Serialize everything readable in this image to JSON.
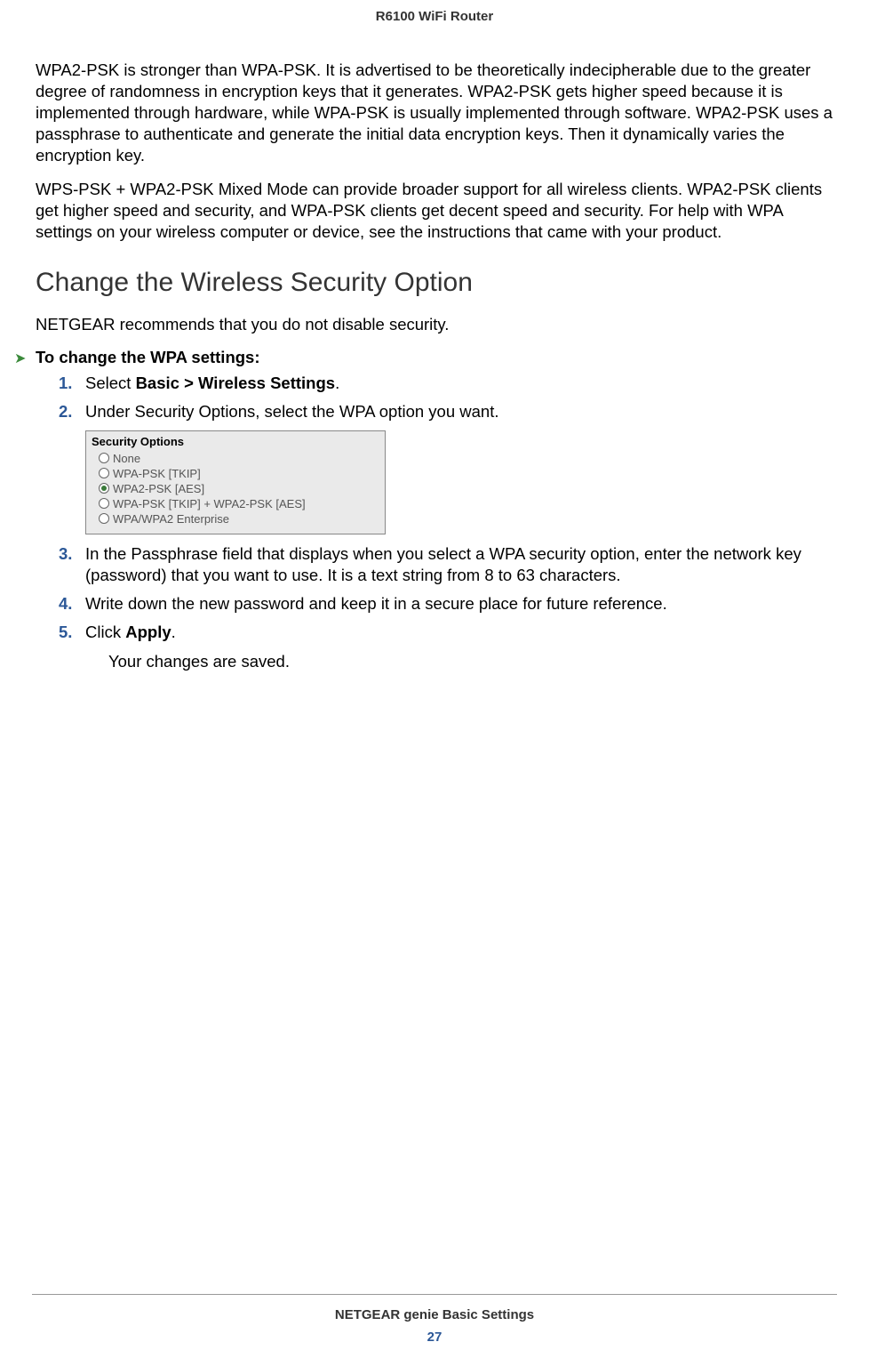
{
  "header": {
    "title": "R6100 WiFi Router"
  },
  "paragraphs": {
    "p1": "WPA2-PSK is stronger than WPA-PSK. It is advertised to be theoretically indecipherable due to the greater degree of randomness in encryption keys that it generates. WPA2-PSK gets higher speed because it is implemented through hardware, while WPA-PSK is usually implemented through software. WPA2-PSK uses a passphrase to authenticate and generate the initial data encryption keys. Then it dynamically varies the encryption key.",
    "p2": "WPS-PSK + WPA2-PSK Mixed Mode can provide broader support for all wireless clients. WPA2-PSK clients get higher speed and security, and WPA-PSK clients get decent speed and security. For help with WPA settings on your wireless computer or device, see the instructions that came with your product."
  },
  "section": {
    "heading": "Change the Wireless Security Option",
    "intro": "NETGEAR recommends that you do not disable security."
  },
  "procedure": {
    "title": "To change the WPA settings:",
    "steps": {
      "s1_pre": "Select ",
      "s1_bold": "Basic > Wireless Settings",
      "s1_post": ".",
      "s2": "Under Security Options, select the WPA option you want.",
      "s3": "In the Passphrase field that displays when you select a WPA security option, enter the network key (password) that you want to use. It is a text string from 8 to 63 characters.",
      "s4": "Write down the new password and keep it in a secure place for future reference.",
      "s5_pre": "Click ",
      "s5_bold": "Apply",
      "s5_post": ".",
      "s5_result": "Your changes are saved."
    },
    "numbers": {
      "n1": "1.",
      "n2": "2.",
      "n3": "3.",
      "n4": "4.",
      "n5": "5."
    }
  },
  "security_options": {
    "title": "Security Options",
    "items": [
      {
        "label": "None",
        "selected": false
      },
      {
        "label": "WPA-PSK [TKIP]",
        "selected": false
      },
      {
        "label": "WPA2-PSK [AES]",
        "selected": true
      },
      {
        "label": "WPA-PSK [TKIP] + WPA2-PSK [AES]",
        "selected": false
      },
      {
        "label": "WPA/WPA2 Enterprise",
        "selected": false
      }
    ]
  },
  "footer": {
    "section": "NETGEAR genie Basic Settings",
    "page": "27"
  }
}
